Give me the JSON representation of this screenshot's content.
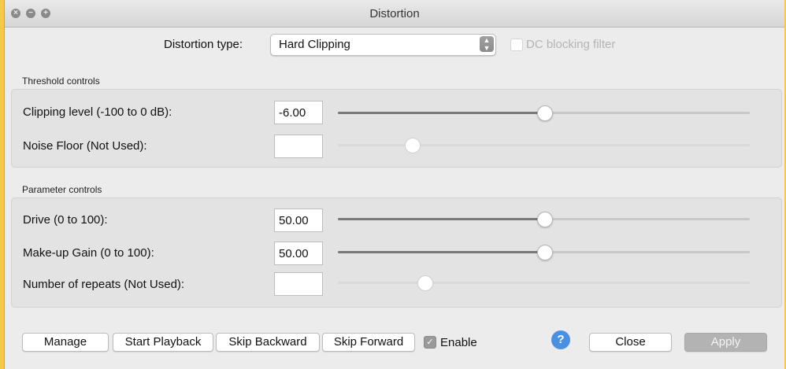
{
  "window": {
    "title": "Distortion"
  },
  "header": {
    "type_label": "Distortion type:",
    "type_value": "Hard Clipping",
    "dc_filter_label": "DC blocking filter",
    "dc_filter_checked": false
  },
  "threshold": {
    "group_label": "Threshold controls",
    "clipping_label": "Clipping level (-100 to 0 dB):",
    "clipping_value": "-6.00",
    "noise_label": "Noise Floor (Not Used):",
    "noise_value": ""
  },
  "parameters": {
    "group_label": "Parameter controls",
    "drive_label": "Drive (0 to 100):",
    "drive_value": "50.00",
    "makeup_label": "Make-up Gain (0 to 100):",
    "makeup_value": "50.00",
    "repeats_label": "Number of repeats (Not Used):",
    "repeats_value": ""
  },
  "sliders": {
    "clipping": 0.5,
    "noise": 0.18,
    "drive": 0.5,
    "makeup": 0.5,
    "repeats": 0.21
  },
  "footer": {
    "manage": "Manage",
    "start_playback": "Start Playback",
    "skip_backward": "Skip Backward",
    "skip_forward": "Skip Forward",
    "enable_label": "Enable",
    "enable_checked": true,
    "help": "?",
    "close": "Close",
    "apply": "Apply"
  },
  "colors": {
    "accent": "#4a90e2",
    "window_bg": "#ececec",
    "desktop": "#f7c948"
  }
}
